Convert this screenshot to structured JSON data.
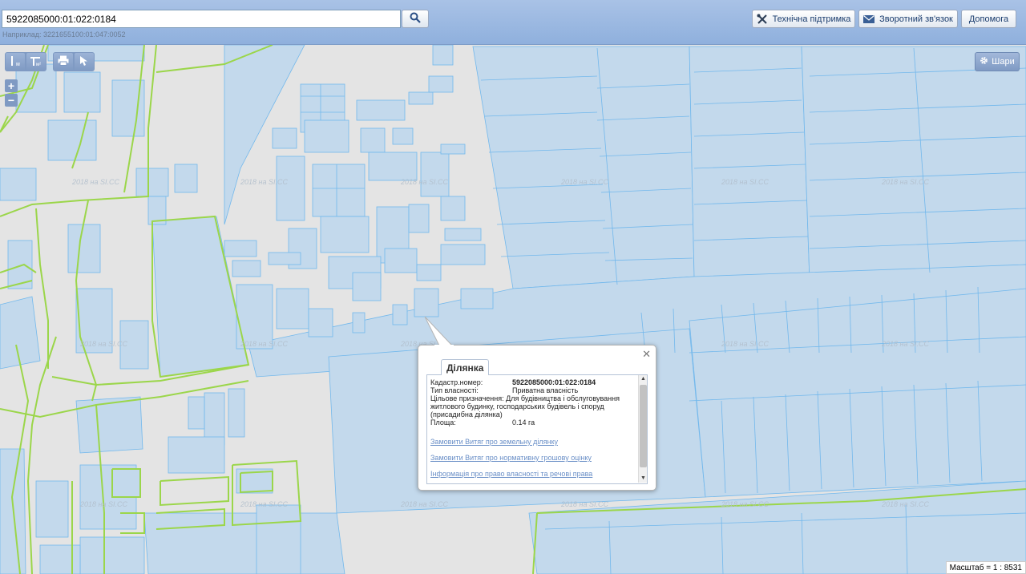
{
  "search": {
    "value": "5922085000:01:022:0184",
    "hint": "Наприклад: 3221655100:01:047:0052"
  },
  "header": {
    "support_label": "Технічна підтримка",
    "feedback_label": "Зворотний зв'язок",
    "help_label": "Допомога"
  },
  "map": {
    "layers_label": "Шари",
    "watermark": "2018 на SI.CC",
    "scale_label": "Масштаб = 1 : 8531"
  },
  "popup": {
    "tab_label": "Ділянка",
    "fields": {
      "cadastre_key": "Кадастр.номер:",
      "cadastre_value": "5922085000:01:022:0184",
      "ownership_key": "Тип власності:",
      "ownership_value": "Приватна власність",
      "purpose_key": "Цільове призначення:",
      "purpose_value": "Для будівництва і обслуговування житлового будинку, господарських будівель і споруд (присадибна ділянка)",
      "area_key": "Площа:",
      "area_value": "0.14 га"
    },
    "links": {
      "land_extract": "Замовити Витяг про земельну ділянку",
      "valuation_extract": "Замовити Витяг про нормативну грошову оцінку",
      "ownership_info": "Інформація про право власності та речові права"
    }
  },
  "colors": {
    "parcel_fill": "#c3d9ec",
    "parcel_stroke": "#72b8ec",
    "boundary_green": "#9bd64a",
    "header_blue": "#9cb7e0"
  }
}
